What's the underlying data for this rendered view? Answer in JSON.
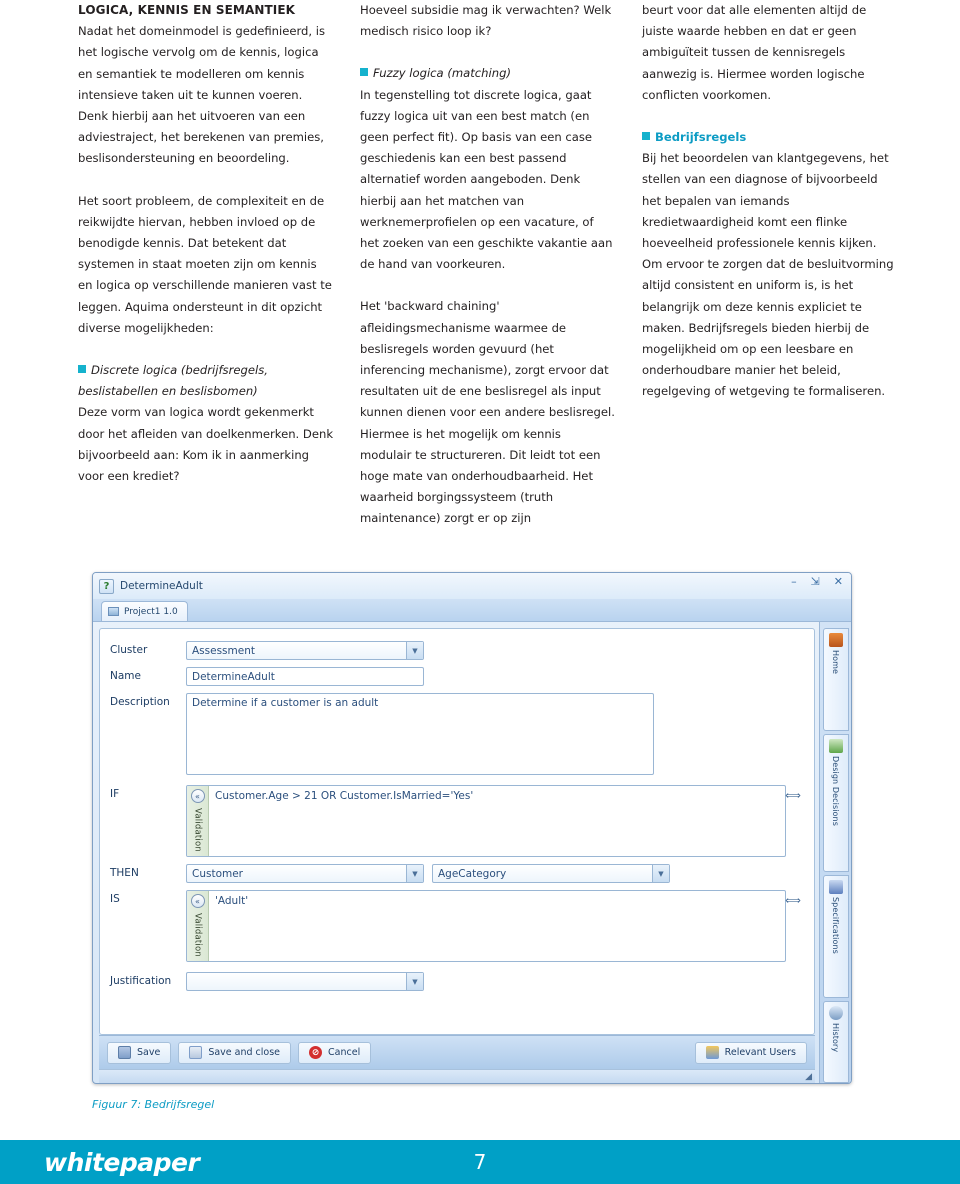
{
  "colors": {
    "teal": "#00a0c6",
    "bullet": "#15b2cd",
    "heading_teal": "#0d9cc4",
    "body_text": "#231f20"
  },
  "columns": [
    {
      "heading": "LOGICA, KENNIS EN SEMANTIEK",
      "blocks": [
        {
          "type": "paragraph",
          "text": "Nadat het domeinmodel is gedefinieerd, is het logische vervolg om de kennis, logica en semantiek te modelleren om kennis intensieve taken uit te kunnen voeren. Denk hierbij aan het uitvoeren van een adviestraject, het berekenen van premies, beslisondersteuning en beoordeling."
        },
        {
          "type": "paragraph",
          "text": "Het soort probleem, de complexiteit en de reikwijdte hiervan, hebben invloed op de benodigde kennis. Dat betekent dat systemen in staat moeten zijn om kennis en logica op verschillende manieren vast te leggen. Aquima ondersteunt in dit opzicht diverse mogelijkheden:"
        },
        {
          "type": "bullet-subhead",
          "text": "Discrete logica (bedrijfsregels, beslistabellen en beslisbomen)"
        },
        {
          "type": "paragraph-tight",
          "text": "Deze vorm van logica wordt gekenmerkt door het afleiden van doelkenmerken. Denk bijvoorbeeld aan: Kom ik in aanmerking voor een krediet?"
        }
      ]
    },
    {
      "heading": "",
      "blocks": [
        {
          "type": "paragraph",
          "text": "Hoeveel subsidie mag ik verwachten? Welk medisch risico loop ik?"
        },
        {
          "type": "bullet-subhead",
          "text": "Fuzzy logica (matching)"
        },
        {
          "type": "paragraph-tight",
          "text": "In tegenstelling tot discrete logica, gaat fuzzy logica uit van een best match (en geen perfect fit). Op basis van een case geschiedenis kan een best passend alternatief worden aangeboden. Denk hierbij aan het matchen van werknemerprofielen op een vacature, of het zoeken van een geschikte vakantie aan de hand van voorkeuren."
        },
        {
          "type": "paragraph",
          "text": "Het 'backward chaining' afleidingsmechanisme waarmee de beslisregels worden gevuurd (het inferencing mechanisme), zorgt ervoor dat resultaten uit de ene beslisregel als input kunnen dienen voor een andere beslisregel. Hiermee is het mogelijk om kennis modulair te structureren. Dit leidt tot een hoge mate van onderhoudbaarheid. Het waarheid borgingssysteem (truth maintenance) zorgt er op zijn"
        }
      ]
    },
    {
      "heading": "",
      "blocks": [
        {
          "type": "paragraph",
          "text": "beurt voor dat alle elementen altijd de juiste waarde hebben en dat er geen ambiguïteit tussen de kennisregels aanwezig is. Hiermee worden logische conflicten voorkomen."
        },
        {
          "type": "bullet-subhead-teal",
          "text": "Bedrijfsregels"
        },
        {
          "type": "paragraph-tight",
          "text": "Bij het beoordelen van klantgegevens, het stellen van een diagnose of bijvoorbeeld het bepalen van iemands kredietwaardigheid komt een flinke hoeveelheid professionele kennis kijken. Om ervoor te zorgen dat de besluitvorming altijd consistent en uniform is, is het belangrijk om deze kennis expliciet te maken. Bedrijfsregels bieden hierbij de mogelijkheid om op een leesbare en onderhoudbare manier het beleid, regelgeving of wetgeving te formaliseren."
        }
      ]
    }
  ],
  "app": {
    "title": "DetermineAdult",
    "title_icon": "question-document-icon",
    "window_buttons": {
      "minimize": "–",
      "restore": "⇲",
      "close": "✕"
    },
    "tab": {
      "label": "Project1 1.0",
      "icon": "project-icon"
    },
    "fields": {
      "cluster": {
        "label": "Cluster",
        "value": "Assessment",
        "type": "combobox"
      },
      "name": {
        "label": "Name",
        "value": "DetermineAdult",
        "type": "text"
      },
      "description": {
        "label": "Description",
        "value": "Determine if a customer is an adult",
        "type": "textarea"
      },
      "if": {
        "label": "IF",
        "value": "Customer.Age > 21 OR Customer.IsMarried='Yes'",
        "validation_tab": "Validation",
        "collapse_icon": "«"
      },
      "then": {
        "label": "THEN",
        "value_left": "Customer",
        "value_right": "AgeCategory"
      },
      "is": {
        "label": "IS",
        "value": "'Adult'",
        "validation_tab": "Validation",
        "collapse_icon": "«"
      },
      "justification": {
        "label": "Justification",
        "value": "",
        "type": "combobox"
      }
    },
    "sidebar_tabs": [
      {
        "label": "Home",
        "icon": "home-icon",
        "color": "#d4762a"
      },
      {
        "label": "Design Decisions",
        "icon": "design-decisions-icon",
        "color": "#5fa64a"
      },
      {
        "label": "Specifications",
        "icon": "specifications-icon",
        "color": "#5c7fbe"
      },
      {
        "label": "History",
        "icon": "history-icon",
        "color": "#7a9dc4"
      }
    ],
    "toolbar": {
      "save": {
        "label": "Save",
        "icon": "save-icon"
      },
      "save_and_close": {
        "label": "Save and close",
        "icon": "save-close-icon"
      },
      "cancel": {
        "label": "Cancel",
        "icon": "cancel-icon"
      },
      "relevant_users": {
        "label": "Relevant Users",
        "icon": "users-icon"
      }
    }
  },
  "caption": "Figuur 7: Bedrijfsregel",
  "footer": {
    "brand": "whitepaper",
    "page": "7"
  }
}
